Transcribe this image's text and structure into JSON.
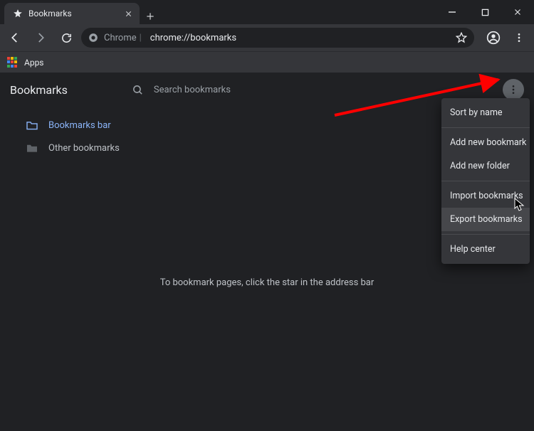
{
  "window": {
    "tab_title": "Bookmarks",
    "url_scheme": "Chrome",
    "url_path": "chrome://bookmarks"
  },
  "bookbar": {
    "apps_label": "Apps"
  },
  "page": {
    "title": "Bookmarks",
    "search_placeholder": "Search bookmarks",
    "empty_hint": "To bookmark pages, click the star in the address bar"
  },
  "sidebar": {
    "items": [
      {
        "label": "Bookmarks bar"
      },
      {
        "label": "Other bookmarks"
      }
    ]
  },
  "menu": {
    "items": [
      "Sort by name",
      "Add new bookmark",
      "Add new folder",
      "Import bookmarks",
      "Export bookmarks",
      "Help center"
    ]
  },
  "annotation": {
    "arrow_color": "#ff0000"
  }
}
